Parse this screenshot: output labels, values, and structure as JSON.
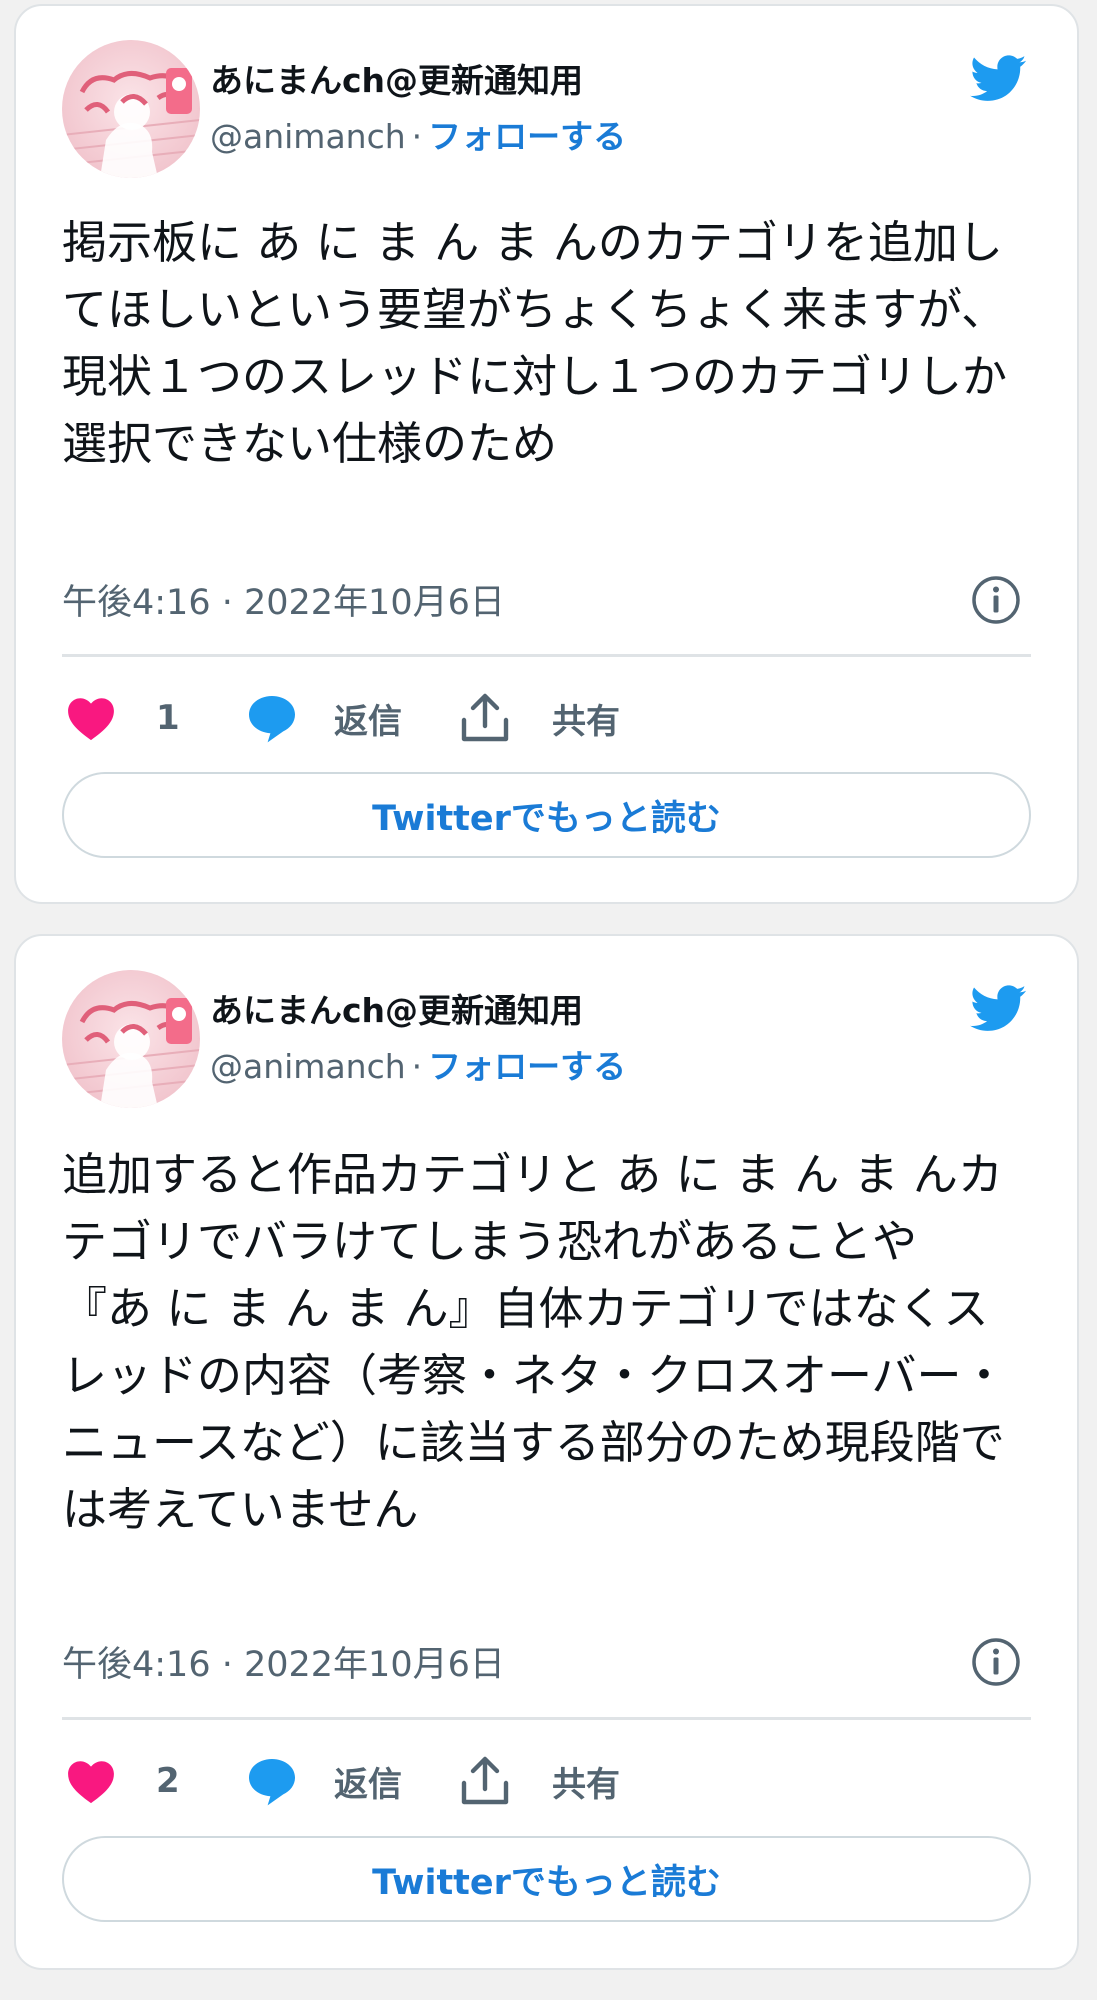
{
  "tweets": [
    {
      "user_name": "あにまんch@更新通知用",
      "handle": "@animanch",
      "separator": "·",
      "follow_label": "フォローする",
      "text": "掲示板に あ に ま ん ま んのカテゴリを追加してほしいという要望がちょくちょく来ますが、現状１つのスレッドに対し１つのカテゴリしか選択できない仕様のため",
      "timestamp": "午後4:16 · 2022年10月6日",
      "like_count": "1",
      "reply_label": "返信",
      "share_label": "共有",
      "read_more_label": "Twitterでもっと読む"
    },
    {
      "user_name": "あにまんch@更新通知用",
      "handle": "@animanch",
      "separator": "·",
      "follow_label": "フォローする",
      "text": "追加すると作品カテゴリと あ に ま ん ま んカテゴリでバラけてしまう恐れがあることや\n『あ に ま ん ま ん』自体カテゴリではなくスレッドの内容（考察・ネタ・クロスオーバー・ニュースなど）に該当する部分のため現段階では考えていません",
      "timestamp": "午後4:16 · 2022年10月6日",
      "like_count": "2",
      "reply_label": "返信",
      "share_label": "共有",
      "read_more_label": "Twitterでもっと読む"
    }
  ],
  "icons": {
    "brand": "twitter-bird-icon",
    "info": "info-icon",
    "like": "heart-icon",
    "reply": "speech-bubble-icon",
    "share": "share-icon"
  },
  "colors": {
    "twitter_blue": "#1d9bf0",
    "link_blue": "#1a7bd6",
    "heart_pink": "#f91880",
    "secondary_text": "#536471"
  }
}
